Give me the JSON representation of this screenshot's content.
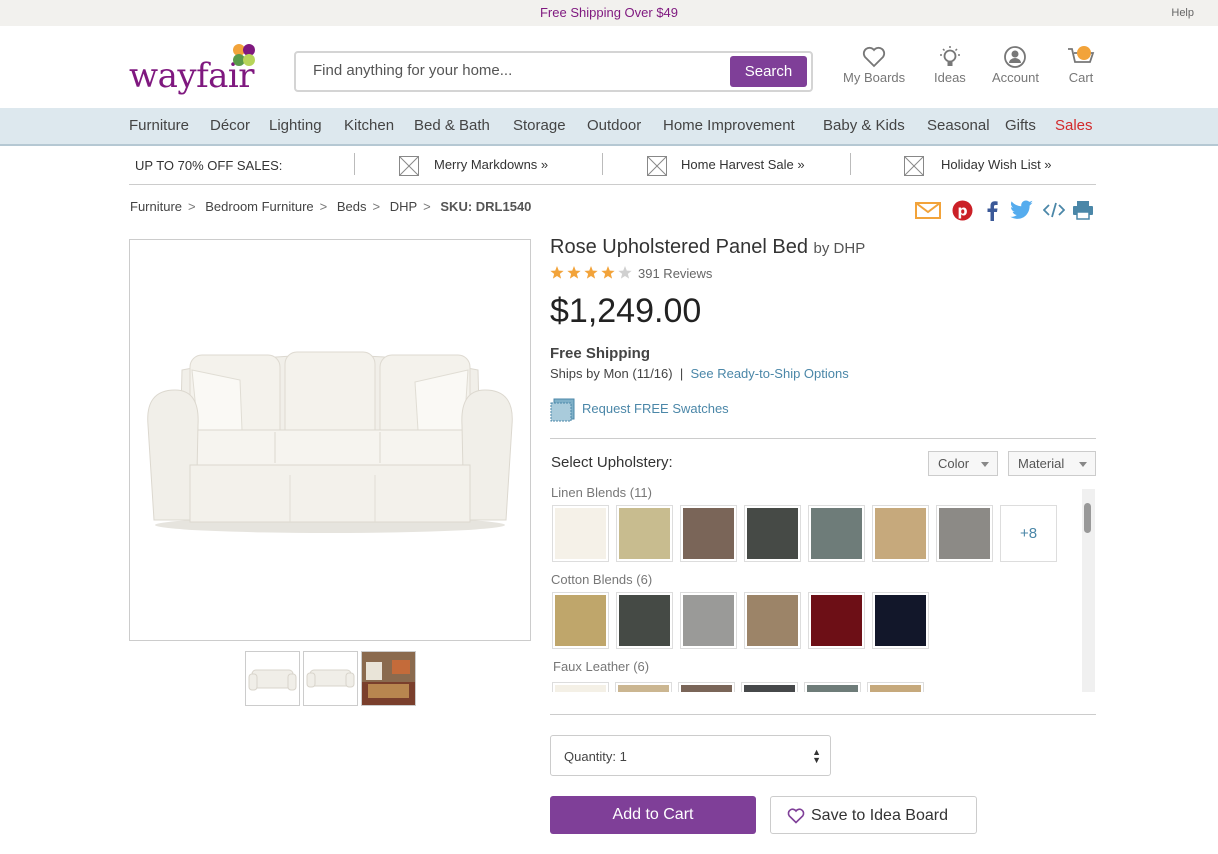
{
  "promo": {
    "shipping": "Free Shipping Over $49",
    "help": "Help"
  },
  "header": {
    "logo": "wayfair",
    "search_placeholder": "Find anything for your home...",
    "search_button": "Search",
    "icons": {
      "boards": "My Boards",
      "ideas": "Ideas",
      "account": "Account",
      "cart": "Cart"
    }
  },
  "nav": [
    "Furniture",
    "Décor",
    "Lighting",
    "Kitchen",
    "Bed & Bath",
    "Storage",
    "Outdoor",
    "Home Improvement",
    "Baby & Kids",
    "Seasonal",
    "Gifts",
    "Sales"
  ],
  "sales_bar": {
    "lead": "UP TO 70% OFF SALES:",
    "items": [
      "Merry Markdowns »",
      "Home Harvest Sale »",
      "Holiday Wish List »"
    ]
  },
  "breadcrumb": [
    "Furniture",
    "Bedroom Furniture",
    "Beds",
    "DHP"
  ],
  "breadcrumb_sep": ">",
  "sku": "SKU: DRL1540",
  "product": {
    "title": "Rose Upholstered Panel Bed",
    "by": "by DHP",
    "rating": 4,
    "rating_max": 5,
    "reviews": "391 Reviews",
    "price": "$1,249.00",
    "free_shipping": "Free Shipping",
    "ships_by": "Ships by Mon (11/16)",
    "ships_sep": "|",
    "ready_to_ship": "See Ready-to-Ship Options",
    "swatches_link": "Request FREE Swatches"
  },
  "upholstery": {
    "label": "Select Upholstery:",
    "filters": [
      "Color",
      "Material"
    ],
    "groups": [
      {
        "name": "Linen Blends (11)",
        "colors": [
          "#f5f1e8",
          "#c8bc8f",
          "#7a6558",
          "#464a46",
          "#6e7c79",
          "#c6a97c",
          "#8c8a86"
        ],
        "more": "+8"
      },
      {
        "name": "Cotton Blends (6)",
        "colors": [
          "#bfa66b",
          "#454a45",
          "#9a9a98",
          "#9c8468",
          "#6d0f16",
          "#12172a"
        ]
      },
      {
        "name": "Faux Leather (6)",
        "colors": [
          "#f4f0e6",
          "#cbb691",
          "#7a6558",
          "#46484a",
          "#6e7c79",
          "#c6a97c"
        ]
      }
    ]
  },
  "quantity": "Quantity: 1",
  "add_to_cart": "Add to Cart",
  "save_board": "Save to Idea Board",
  "colors": {
    "brand": "#7f187f",
    "button": "#7f3f98",
    "link": "#4b87a8",
    "sales": "#d3292b",
    "star": "#f2a33a"
  }
}
